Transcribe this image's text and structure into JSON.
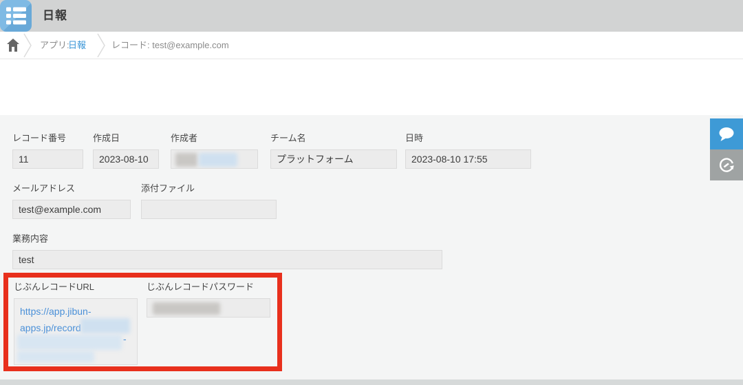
{
  "header": {
    "title": "日報",
    "app_icon": "list-icon"
  },
  "breadcrumb": {
    "home_icon": "home-icon",
    "app_prefix": "アプリ:",
    "app_link": "日報",
    "record_crumb": "レコード: test@example.com"
  },
  "fields": {
    "record_number": {
      "label": "レコード番号",
      "value": "11"
    },
    "created_date": {
      "label": "作成日",
      "value": "2023-08-10"
    },
    "creator": {
      "label": "作成者",
      "value": ""
    },
    "team_name": {
      "label": "チーム名",
      "value": "プラットフォーム"
    },
    "datetime": {
      "label": "日時",
      "value": "2023-08-10 17:55"
    },
    "email": {
      "label": "メールアドレス",
      "value": "test@example.com"
    },
    "attachment": {
      "label": "添付ファイル",
      "value": ""
    },
    "work_content": {
      "label": "業務内容",
      "value": "test"
    },
    "record_url": {
      "label": "じぶんレコードURL",
      "url_line1": "https://app.jibun-",
      "url_line2": "apps.jp/record",
      "redacted_suffix": "-"
    },
    "record_password": {
      "label": "じぶんレコードパスワード",
      "value": ""
    }
  },
  "side_panel": {
    "comment_button": "comment-bubble-icon",
    "history_button": "history-clock-icon"
  },
  "colors": {
    "header_gray": "#d2d3d3",
    "app_icon_blue": "#7fbae4",
    "link_blue": "#4a90d8",
    "breadcrumb_link_blue": "#3a96d7",
    "comment_btn_blue": "#3e9ad6",
    "history_btn_gray": "#9fa3a3",
    "highlight_red": "#e8301d",
    "content_bg": "#f4f5f5",
    "field_box_bg": "#ececec"
  }
}
